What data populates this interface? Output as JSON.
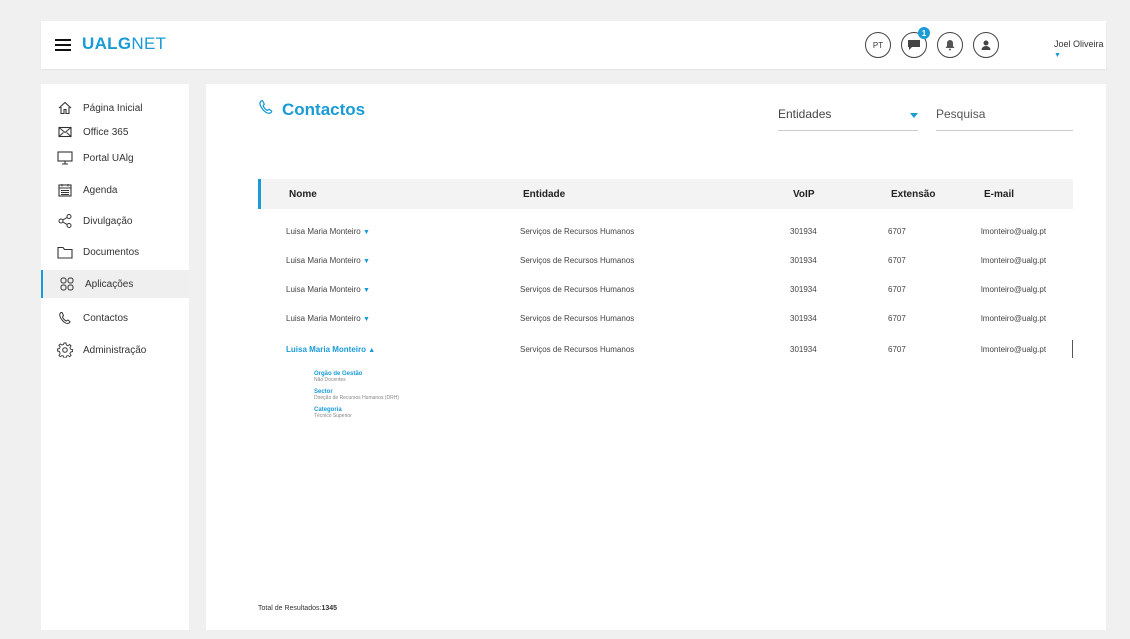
{
  "header": {
    "logo_bold": "UALG",
    "logo_light": "NET",
    "language": "PT",
    "messages_badge": "1",
    "user_name": "Joel Oliveira"
  },
  "sidebar": {
    "items": [
      {
        "label": "Página Inicial",
        "icon": "home-icon"
      },
      {
        "label": "Office 365",
        "icon": "mail-icon"
      },
      {
        "label": "Portal UAlg",
        "icon": "monitor-icon"
      },
      {
        "label": "Agenda",
        "icon": "calendar-icon"
      },
      {
        "label": "Divulgação",
        "icon": "share-icon"
      },
      {
        "label": "Documentos",
        "icon": "folder-icon"
      },
      {
        "label": "Aplicações",
        "icon": "apps-icon",
        "active": true
      },
      {
        "label": "Contactos",
        "icon": "phone-icon"
      },
      {
        "label": "Administração",
        "icon": "gear-icon"
      }
    ]
  },
  "main": {
    "title": "Contactos",
    "entidades_label": "Entidades",
    "search_placeholder": "Pesquisa",
    "columns": [
      "Nome",
      "Entidade",
      "VoIP",
      "Extensão",
      "E-mail"
    ],
    "rows": [
      {
        "name": "Luisa Maria Monteiro",
        "entidade": "Serviços de Recursos Humanos",
        "voip": "301934",
        "extensao": "6707",
        "email": "lmonteiro@ualg.pt"
      },
      {
        "name": "Luisa Maria Monteiro",
        "entidade": "Serviços de Recursos Humanos",
        "voip": "301934",
        "extensao": "6707",
        "email": "lmonteiro@ualg.pt"
      },
      {
        "name": "Luisa Maria Monteiro",
        "entidade": "Serviços de Recursos Humanos",
        "voip": "301934",
        "extensao": "6707",
        "email": "lmonteiro@ualg.pt"
      },
      {
        "name": "Luisa Maria Monteiro",
        "entidade": "Serviços de Recursos Humanos",
        "voip": "301934",
        "extensao": "6707",
        "email": "lmonteiro@ualg.pt"
      },
      {
        "name": "Luisa Maria Monteiro",
        "entidade": "Serviços de Recursos Humanos",
        "voip": "301934",
        "extensao": "6707",
        "email": "lmonteiro@ualg.pt",
        "expanded": true
      }
    ],
    "details": [
      {
        "label": "Orgão de Gestão",
        "value": "Não Docentes"
      },
      {
        "label": "Sector",
        "value": "Direção de Recursos Humanos (DRH)"
      },
      {
        "label": "Categoria",
        "value": "Técnico Superior"
      }
    ],
    "total_label": "Total de Resultados:",
    "total_value": "1345"
  },
  "colors": {
    "accent": "#1a9bd7"
  }
}
